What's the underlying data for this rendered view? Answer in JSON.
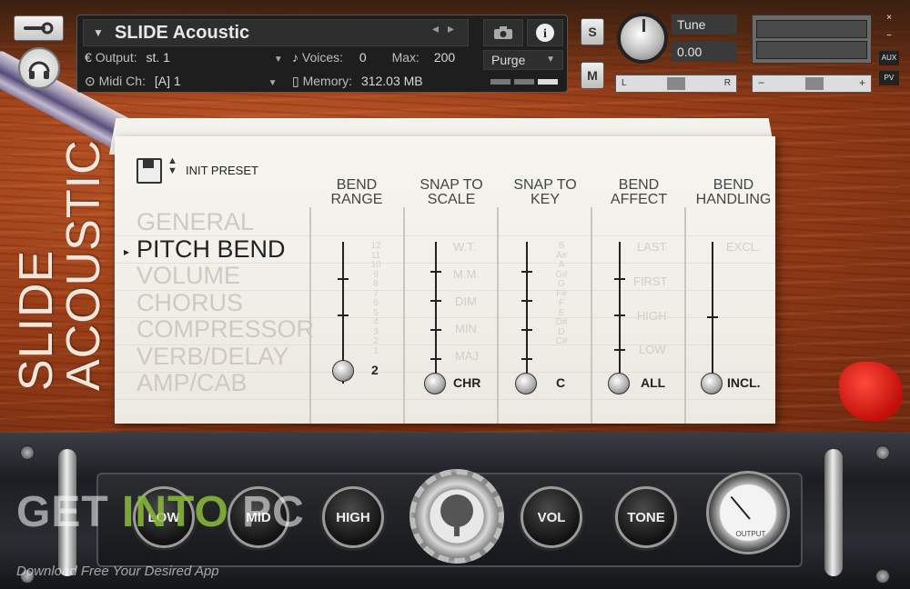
{
  "header": {
    "instrument_name": "SLIDE Acoustic",
    "output_label": "Output:",
    "output_value": "st. 1",
    "voices_label": "Voices:",
    "voices_value": "0",
    "max_label": "Max:",
    "max_value": "200",
    "midi_label": "Midi Ch:",
    "midi_value": "[A]  1",
    "memory_label": "Memory:",
    "memory_value": "312.03 MB",
    "purge_label": "Purge",
    "solo_label": "S",
    "mute_label": "M",
    "tune_label": "Tune",
    "tune_value": "0.00",
    "pan_left": "L",
    "pan_right": "R",
    "aux_label": "AUX",
    "pv_label": "PV",
    "close_glyph": "×",
    "minimize_glyph": "−",
    "info_glyph": "i"
  },
  "title_vertical": [
    "SLIDE",
    "ACOUSTIC"
  ],
  "preset": {
    "label": "INIT PRESET"
  },
  "menu": {
    "items": [
      "GENERAL",
      "PITCH BEND",
      "VOLUME",
      "CHORUS",
      "COMPRESSOR",
      "VERB/DELAY",
      "AMP/CAB"
    ],
    "active_index": 1,
    "active_marker": "▸"
  },
  "columns": [
    {
      "header": [
        "BEND",
        "RANGE"
      ],
      "value": "2",
      "ghost_values": [
        "12",
        "11",
        "10",
        "9",
        "8",
        "7",
        "6",
        "5",
        "4",
        "3",
        "2",
        "1"
      ]
    },
    {
      "header": [
        "SNAP TO",
        "SCALE"
      ],
      "value": "CHR",
      "ghost_values": [
        "W.T.",
        "M.M.",
        "DIM",
        "MIN",
        "MAJ"
      ]
    },
    {
      "header": [
        "SNAP TO",
        "KEY"
      ],
      "value": "C",
      "ghost_values": [
        "B",
        "A#",
        "A",
        "G#",
        "G",
        "F#",
        "F",
        "E",
        "D#",
        "D",
        "C#"
      ]
    },
    {
      "header": [
        "BEND",
        "AFFECT"
      ],
      "value": "ALL",
      "ghost_values": [
        "LAST",
        "FIRST",
        "HIGH",
        "LOW"
      ]
    },
    {
      "header": [
        "BEND",
        "HANDLING"
      ],
      "value": "INCL.",
      "ghost_values": [
        "EXCL."
      ]
    }
  ],
  "amp": {
    "knobs": [
      "LOW",
      "MID",
      "HIGH",
      "VOL",
      "TONE"
    ],
    "vu_label": "OUTPUT"
  },
  "watermark": {
    "get": "GET",
    "into": "INTO",
    "pc": "PC",
    "sub": "Download Free Your Desired App"
  }
}
